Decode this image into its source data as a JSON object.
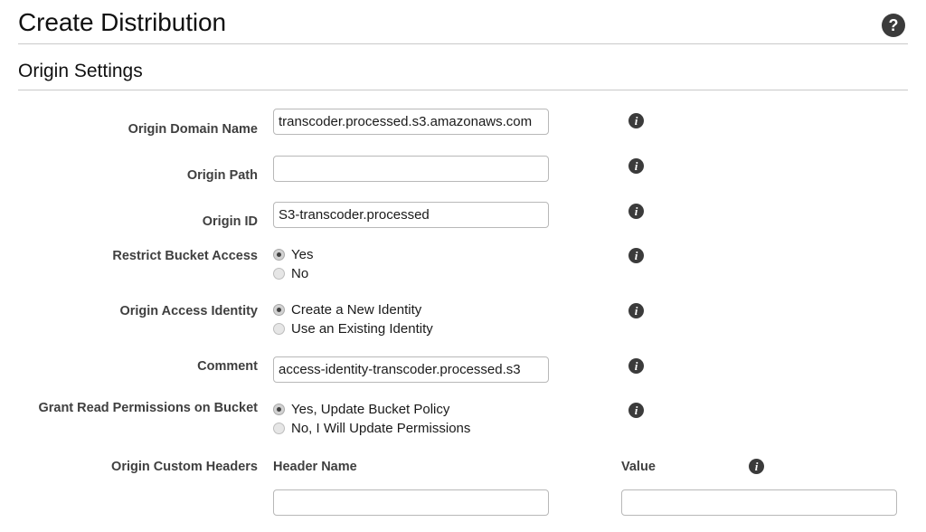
{
  "header": {
    "title": "Create Distribution",
    "help_icon": "help-circle-icon",
    "help_glyph": "?"
  },
  "section": {
    "title": "Origin Settings"
  },
  "info_glyph": "i",
  "fields": {
    "origin_domain_name": {
      "label": "Origin Domain Name",
      "value": "transcoder.processed.s3.amazonaws.com",
      "placeholder": ""
    },
    "origin_path": {
      "label": "Origin Path",
      "value": "",
      "placeholder": ""
    },
    "origin_id": {
      "label": "Origin ID",
      "value": "S3-transcoder.processed",
      "placeholder": ""
    },
    "restrict_bucket_access": {
      "label": "Restrict Bucket Access",
      "options": [
        {
          "label": "Yes",
          "checked": true
        },
        {
          "label": "No",
          "checked": false
        }
      ]
    },
    "origin_access_identity": {
      "label": "Origin Access Identity",
      "options": [
        {
          "label": "Create a New Identity",
          "checked": true
        },
        {
          "label": "Use an Existing Identity",
          "checked": false
        }
      ]
    },
    "comment": {
      "label": "Comment",
      "value": "access-identity-transcoder.processed.s3",
      "placeholder": ""
    },
    "grant_read_permissions": {
      "label": "Grant Read Permissions on Bucket",
      "options": [
        {
          "label": "Yes, Update Bucket Policy",
          "checked": true
        },
        {
          "label": "No, I Will Update Permissions",
          "checked": false
        }
      ]
    },
    "origin_custom_headers": {
      "label": "Origin Custom Headers",
      "header_name_column": "Header Name",
      "value_column": "Value",
      "rows": [
        {
          "header_name": "",
          "value": ""
        }
      ]
    }
  },
  "colors": {
    "icon_dark": "#3b3b3b",
    "label_text": "#3f3f3f",
    "input_border": "#b8b8b8",
    "divider": "#c9c9c9"
  }
}
